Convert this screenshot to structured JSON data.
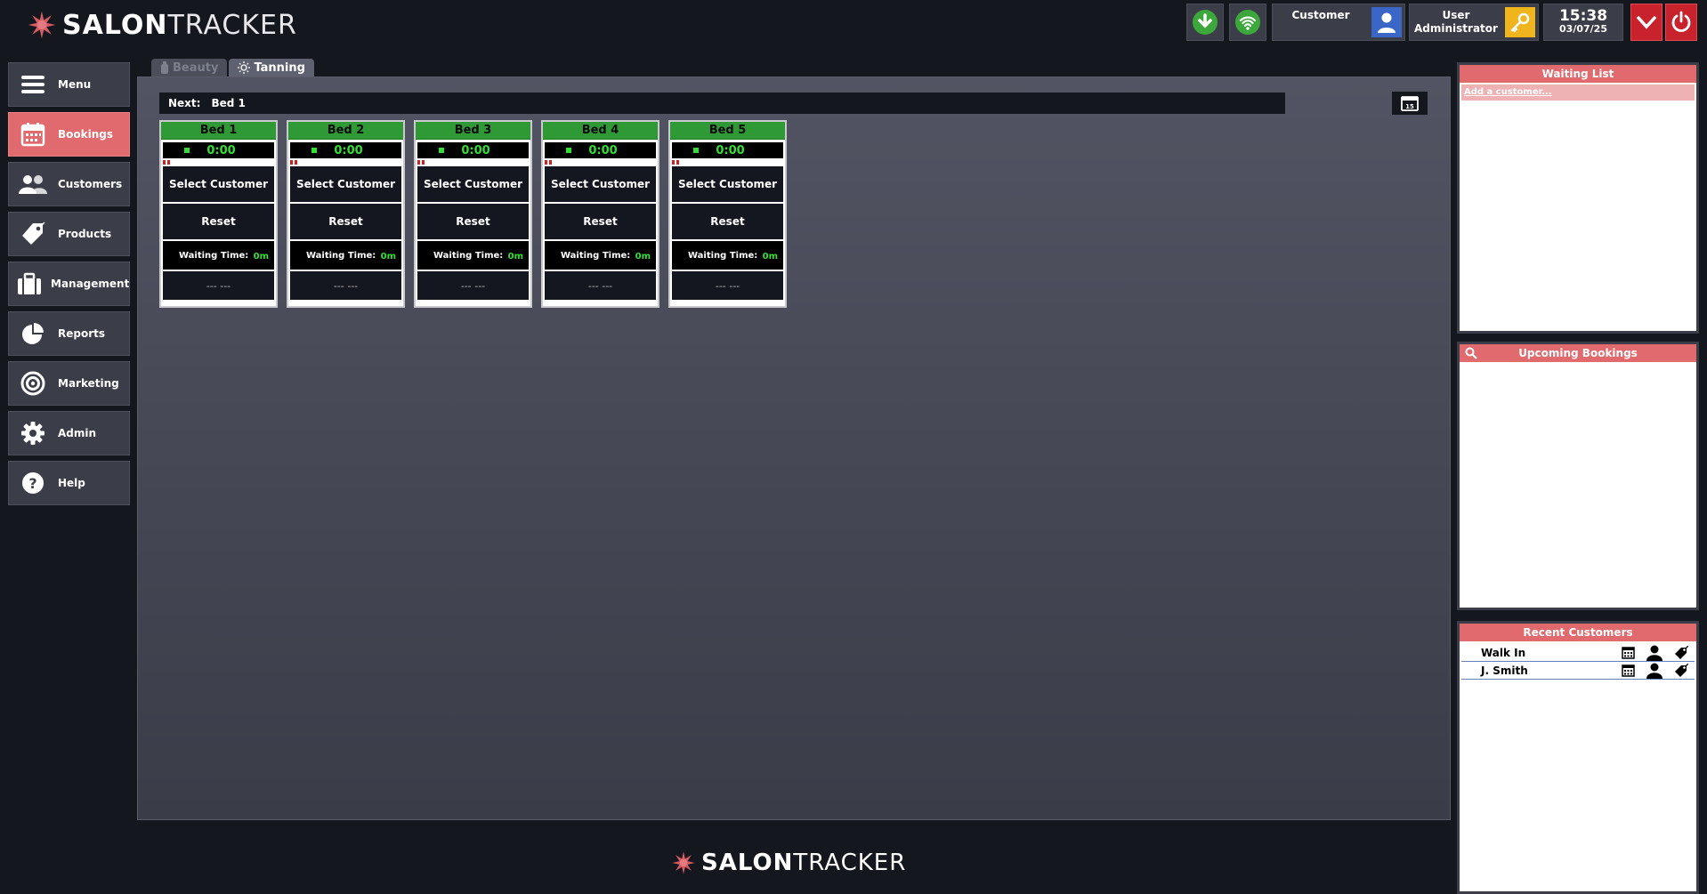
{
  "app": {
    "logo_bold": "SALON",
    "logo_light": "TRACKER"
  },
  "header": {
    "customer_label": "Customer",
    "user_label_1": "User",
    "user_label_2": "Administrator",
    "time": "15:38",
    "date": "03/07/25"
  },
  "sidebar": {
    "items": [
      {
        "label": "Menu",
        "icon": "menu-icon"
      },
      {
        "label": "Bookings",
        "icon": "calendar-icon",
        "active": true
      },
      {
        "label": "Customers",
        "icon": "users-icon"
      },
      {
        "label": "Products",
        "icon": "tag-icon"
      },
      {
        "label": "Management",
        "icon": "briefcase-icon"
      },
      {
        "label": "Reports",
        "icon": "pie-chart-icon"
      },
      {
        "label": "Marketing",
        "icon": "target-icon"
      },
      {
        "label": "Admin",
        "icon": "gear-icon"
      },
      {
        "label": "Help",
        "icon": "help-icon"
      }
    ]
  },
  "tabs": [
    {
      "label": "Beauty",
      "active": false
    },
    {
      "label": "Tanning",
      "active": true
    }
  ],
  "next_bar": {
    "label": "Next:",
    "value": "Bed 1"
  },
  "beds": [
    {
      "name": "Bed 1",
      "timer": "0:00",
      "select_label": "Select Customer",
      "reset_label": "Reset",
      "waiting_label": "Waiting Time:",
      "waiting_value": "0m",
      "customer": "--- ---"
    },
    {
      "name": "Bed 2",
      "timer": "0:00",
      "select_label": "Select Customer",
      "reset_label": "Reset",
      "waiting_label": "Waiting Time:",
      "waiting_value": "0m",
      "customer": "--- ---"
    },
    {
      "name": "Bed 3",
      "timer": "0:00",
      "select_label": "Select Customer",
      "reset_label": "Reset",
      "waiting_label": "Waiting Time:",
      "waiting_value": "0m",
      "customer": "--- ---"
    },
    {
      "name": "Bed 4",
      "timer": "0:00",
      "select_label": "Select Customer",
      "reset_label": "Reset",
      "waiting_label": "Waiting Time:",
      "waiting_value": "0m",
      "customer": "--- ---"
    },
    {
      "name": "Bed 5",
      "timer": "0:00",
      "select_label": "Select Customer",
      "reset_label": "Reset",
      "waiting_label": "Waiting Time:",
      "waiting_value": "0m",
      "customer": "--- ---"
    }
  ],
  "waiting_list": {
    "title": "Waiting List",
    "add_label": "Add a customer..."
  },
  "upcoming": {
    "title": "Upcoming Bookings"
  },
  "recent": {
    "title": "Recent Customers",
    "customers": [
      {
        "name": "Walk In"
      },
      {
        "name": "J. Smith"
      }
    ]
  },
  "colors": {
    "accent": "#e06a6e",
    "bed_header": "#2f9a35",
    "timer": "#32e032",
    "background": "#15171f"
  }
}
